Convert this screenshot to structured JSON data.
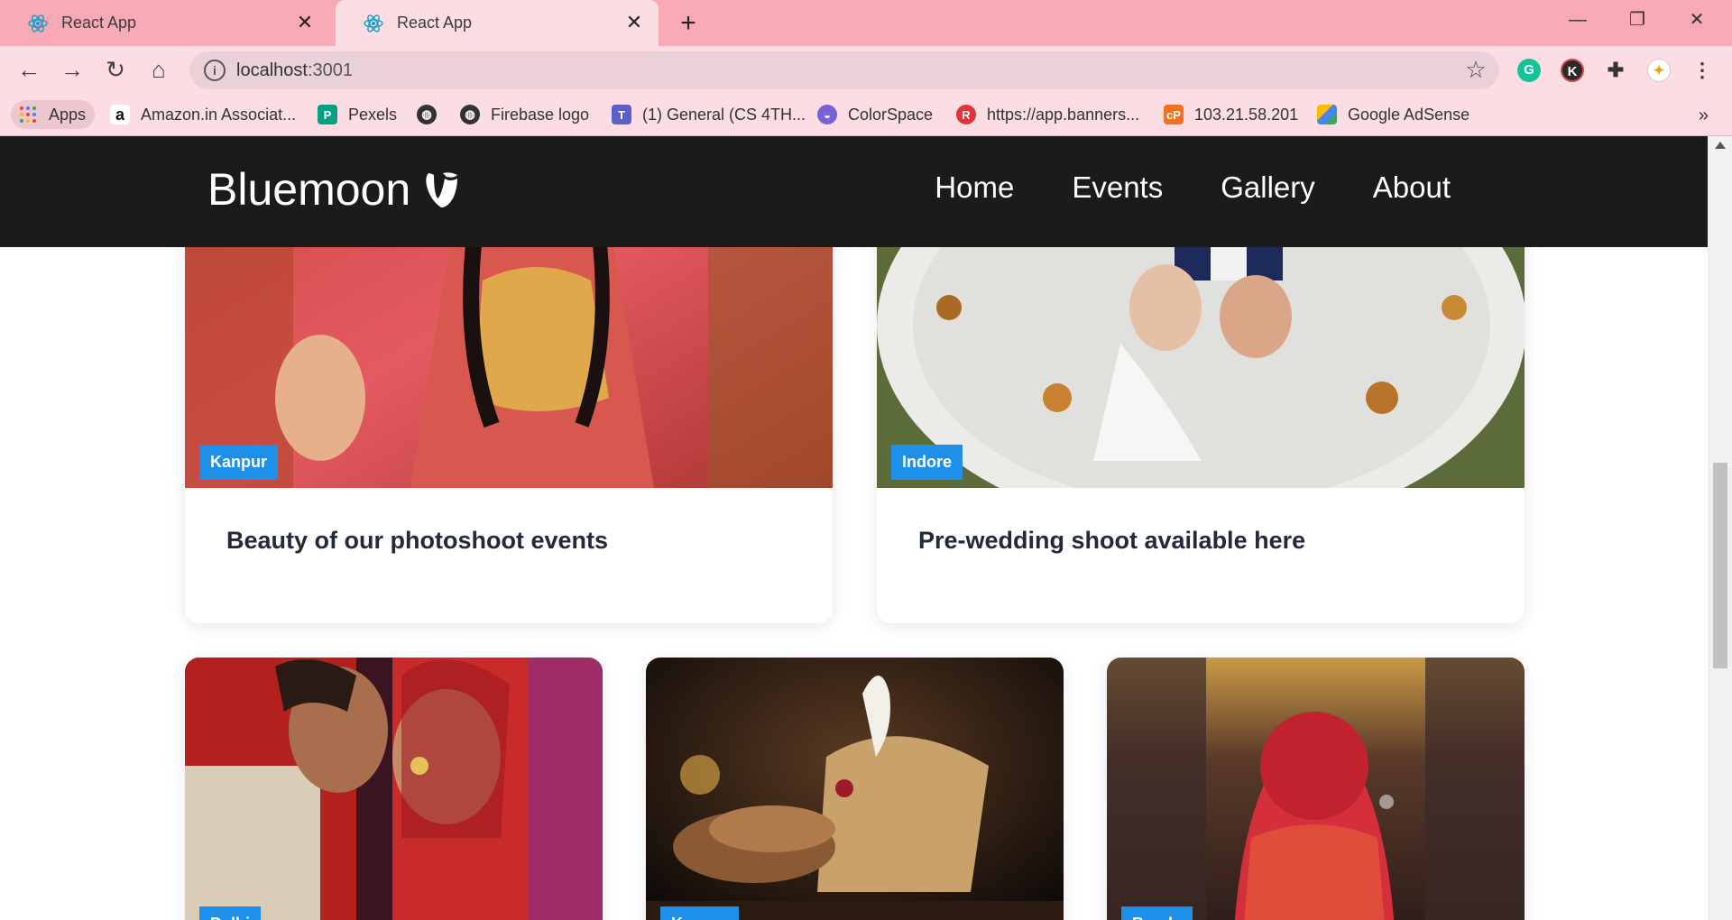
{
  "browser": {
    "tabs": [
      {
        "title": "React App"
      },
      {
        "title": "React App"
      }
    ],
    "url": {
      "host": "localhost",
      "port": ":3001"
    },
    "bookmarks": [
      {
        "label": "Apps"
      },
      {
        "label": "Amazon.in Associat..."
      },
      {
        "label": "Pexels"
      },
      {
        "label": ""
      },
      {
        "label": "Firebase logo"
      },
      {
        "label": "(1) General (CS 4TH..."
      },
      {
        "label": "ColorSpace"
      },
      {
        "label": "https://app.banners..."
      },
      {
        "label": "103.21.58.201"
      },
      {
        "label": "Google AdSense"
      }
    ],
    "profile_initial": "K"
  },
  "site": {
    "brand": "Bluemoon",
    "nav": [
      {
        "label": "Home"
      },
      {
        "label": "Events"
      },
      {
        "label": "Gallery"
      },
      {
        "label": "About"
      }
    ]
  },
  "cards": [
    {
      "location": "Kanpur",
      "title": "Beauty of our photoshoot events"
    },
    {
      "location": "Indore",
      "title": "Pre-wedding shoot available here"
    },
    {
      "location": "Delhi",
      "title": ""
    },
    {
      "location": "Kanpur",
      "title": ""
    },
    {
      "location": "Banda",
      "title": ""
    }
  ],
  "colors": {
    "tab_strip": "#f7a9b6",
    "toolbar": "#fbdde3",
    "navbar": "#1b1b1b",
    "tag": "#1e90ea",
    "card_title": "#222a3a"
  }
}
